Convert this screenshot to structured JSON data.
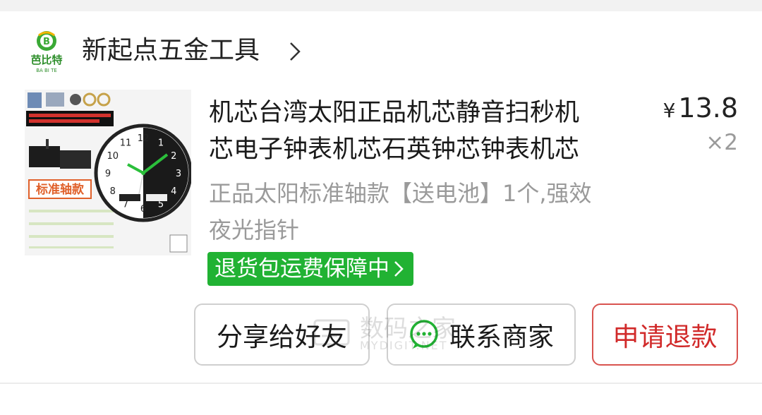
{
  "shop": {
    "logo_text": "芭比特",
    "logo_sub": "BA BI TE",
    "name": "新起点五金工具"
  },
  "product": {
    "title_line1": "机芯台湾太阳正品机芯静音扫秒机",
    "title_line2": "芯电子钟表机芯石英钟芯钟表机芯",
    "price_symbol": "¥",
    "price": "13.8",
    "quantity": "×2",
    "spec_line1": "正品太阳标准轴款【送电池】1个,强效",
    "spec_line2": "夜光指针",
    "badge": "退货包运费保障中",
    "thumb": {
      "label": "标准轴款",
      "clock_numbers": [
        "11",
        "12",
        "1",
        "2",
        "3",
        "4",
        "5",
        "6",
        "7",
        "8",
        "9",
        "10"
      ]
    }
  },
  "buttons": {
    "share": "分享给好友",
    "contact": "联系商家",
    "refund": "申请退款"
  },
  "watermark": {
    "text": "数码之家",
    "sub": "MYDIGIT.NET"
  },
  "colors": {
    "badge_green": "#21b233",
    "refund_red": "#d12a2a",
    "background": "#f2f2f2"
  }
}
